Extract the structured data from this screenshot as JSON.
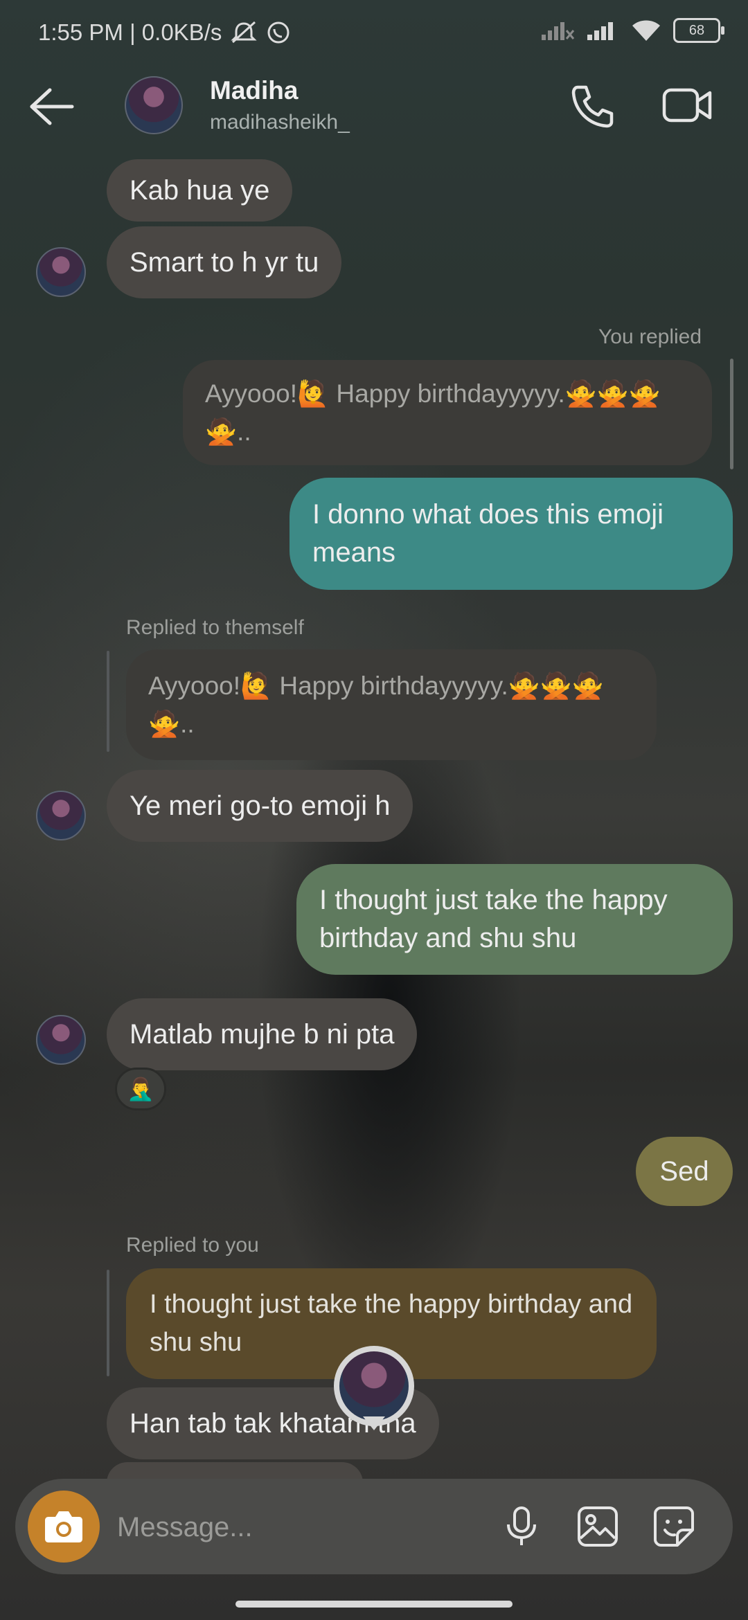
{
  "status_bar": {
    "time_speed": "1:55 PM | 0.0KB/s",
    "battery": "68"
  },
  "header": {
    "name": "Madiha",
    "username": "madihasheikh_"
  },
  "messages": {
    "m1": "Kab hua ye",
    "m2": "Smart to h yr tu",
    "you_replied": "You replied",
    "quote1": "Ayyooo!🙋 Happy birthdayyyyy.🙅🙅🙅\n🙅..",
    "m3": "I donno what does this emoji means",
    "replied_themself": "Replied to themself",
    "quote2": "Ayyooo!🙋 Happy birthdayyyyy.🙅🙅🙅\n🙅..",
    "m4": "Ye meri go-to emoji h",
    "m5": "I thought just take the happy birthday and shu shu",
    "m6": "Matlab mujhe b ni pta",
    "reaction": "🤦‍♂️",
    "m7": "Sed",
    "replied_you": "Replied to you",
    "quote3": "I thought just take the happy birthday and shu shu",
    "m8": "Han tab tak khatam tha"
  },
  "composer": {
    "placeholder": "Message..."
  },
  "colors": {
    "bubble_teal": "#3d8a86",
    "bubble_green": "#5f7a5e",
    "bubble_olive": "#7b7545",
    "quote_gold": "#5a4a2b",
    "camera": "#c5822a"
  },
  "icons": [
    "back-arrow-icon",
    "phone-icon",
    "video-call-icon",
    "camera-icon",
    "microphone-icon",
    "gallery-icon",
    "sticker-icon",
    "wifi-icon",
    "signal-icon",
    "mute-icon",
    "whatsapp-icon"
  ]
}
